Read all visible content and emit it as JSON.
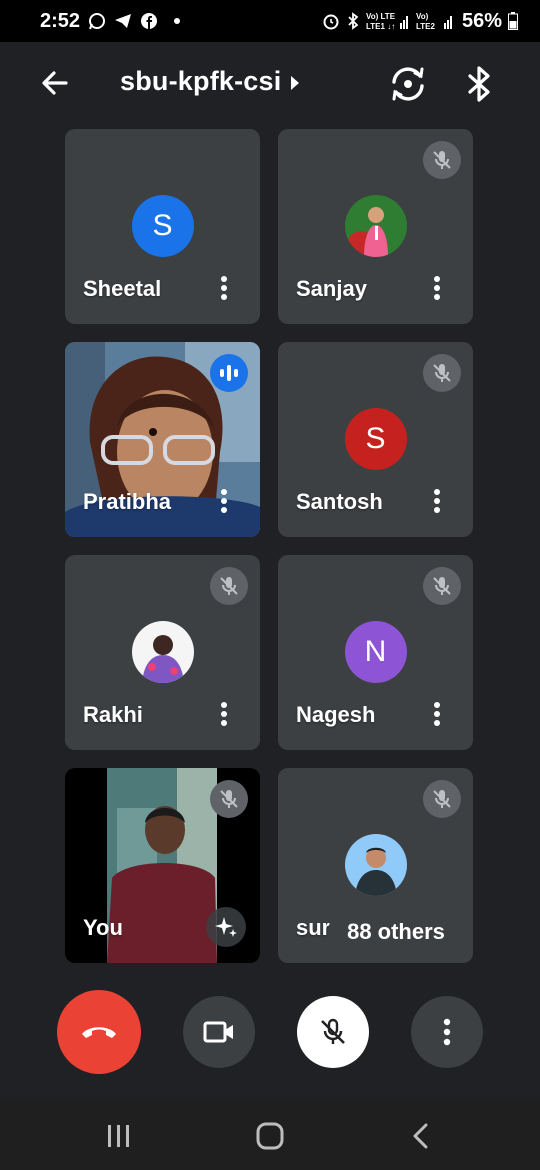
{
  "status_bar": {
    "time": "2:52",
    "network_1": "Vo) LTE\nLTE1",
    "network_2": "Vo)\nLTE2",
    "battery": "56%"
  },
  "app_bar": {
    "title": "sbu-kpfk-csi",
    "icons": [
      "back-arrow-icon",
      "camera-switch-icon",
      "bluetooth-icon"
    ]
  },
  "participants": [
    {
      "name": "Sheetal",
      "avatar_letter": "S",
      "avatar_color": "#1a73e8",
      "muted": false
    },
    {
      "name": "Sanjay",
      "avatar_type": "photo",
      "muted": true
    },
    {
      "name": "Pratibha",
      "video": true,
      "speaking": true
    },
    {
      "name": "Santosh",
      "avatar_letter": "S",
      "avatar_color": "#c5221f",
      "muted": true
    },
    {
      "name": "Rakhi",
      "avatar_type": "photo",
      "muted": true
    },
    {
      "name": "Nagesh",
      "avatar_letter": "N",
      "avatar_color": "#8e54d6",
      "muted": true
    },
    {
      "name": "You",
      "video": true,
      "muted": true
    },
    {
      "name": "suraj...",
      "avatar_type": "photo",
      "muted": true
    }
  ],
  "others_pill": "88 others",
  "controls": {
    "end_call_color": "#ea4335",
    "buttons": [
      "end-call",
      "camera",
      "microphone-off",
      "more-options"
    ]
  }
}
